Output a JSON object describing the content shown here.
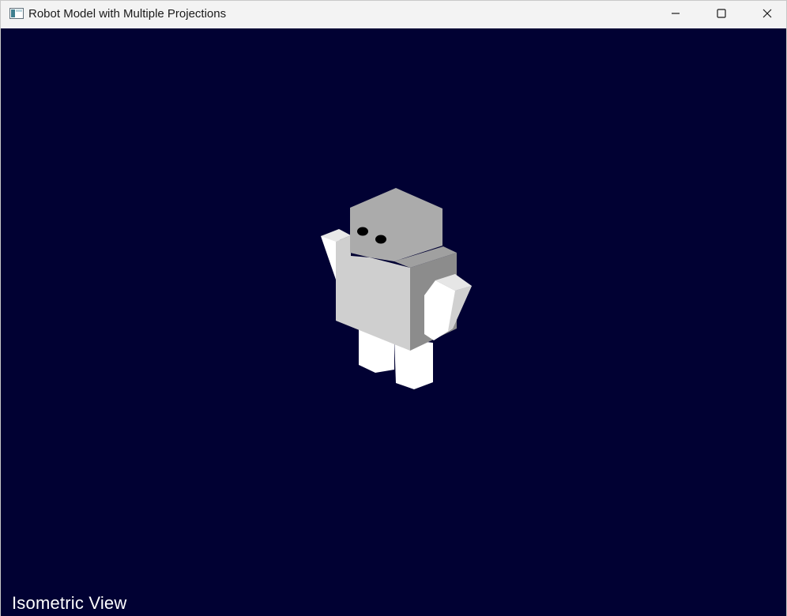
{
  "window": {
    "title": "Robot Model with Multiple Projections",
    "icon": "app-window-icon",
    "controls": {
      "minimize_icon": "minimize-icon",
      "maximize_icon": "maximize-icon",
      "close_icon": "close-icon"
    }
  },
  "viewport": {
    "background_color": "#010133",
    "view_label": "Isometric View"
  },
  "robot": {
    "parts": [
      "head",
      "left-eye",
      "right-eye",
      "torso",
      "left-arm",
      "right-arm",
      "left-leg",
      "right-leg"
    ],
    "colors": {
      "light": "#ffffff",
      "face": "#cfcfcf",
      "mid": "#a9a9a9",
      "dark": "#8c8c8c",
      "eye": "#000000"
    }
  }
}
